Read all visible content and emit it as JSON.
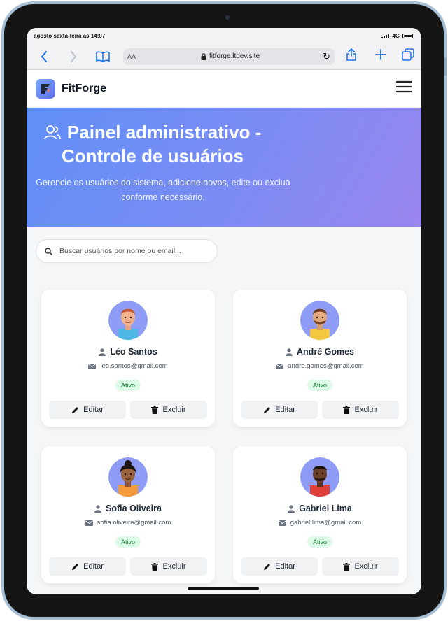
{
  "status_bar": {
    "time_date": "agosto sexta-feira às 14:07",
    "network": "4G"
  },
  "browser": {
    "text_size": "AA",
    "url": "fitforge.ltdev.site"
  },
  "app": {
    "brand": "FitForge"
  },
  "hero": {
    "title": "Painel administrativo - Controle de usuários",
    "subtitle": "Gerencie os usuários do sistema, adicione novos, edite ou exclua conforme necessário."
  },
  "search": {
    "placeholder": "Buscar usuários por nome ou email..."
  },
  "users": [
    {
      "name": "Léo Santos",
      "email": "leo.santos@gmail.com",
      "status": "Ativo",
      "edit_label": "Editar",
      "delete_label": "Excluir"
    },
    {
      "name": "André Gomes",
      "email": "andre.gomes@gmail.com",
      "status": "Ativo",
      "edit_label": "Editar",
      "delete_label": "Excluir"
    },
    {
      "name": "Sofia Oliveira",
      "email": "sofia.oliveira@gmail.com",
      "status": "Ativo",
      "edit_label": "Editar",
      "delete_label": "Excluir"
    },
    {
      "name": "Gabriel Lima",
      "email": "gabriel.lima@gmail.com",
      "status": "Ativo",
      "edit_label": "Editar",
      "delete_label": "Excluir"
    }
  ],
  "colors": {
    "accent": "#5f8ff7",
    "hero_end": "#9a86ee",
    "badge_bg": "#dcfce7",
    "badge_text": "#15803d"
  }
}
